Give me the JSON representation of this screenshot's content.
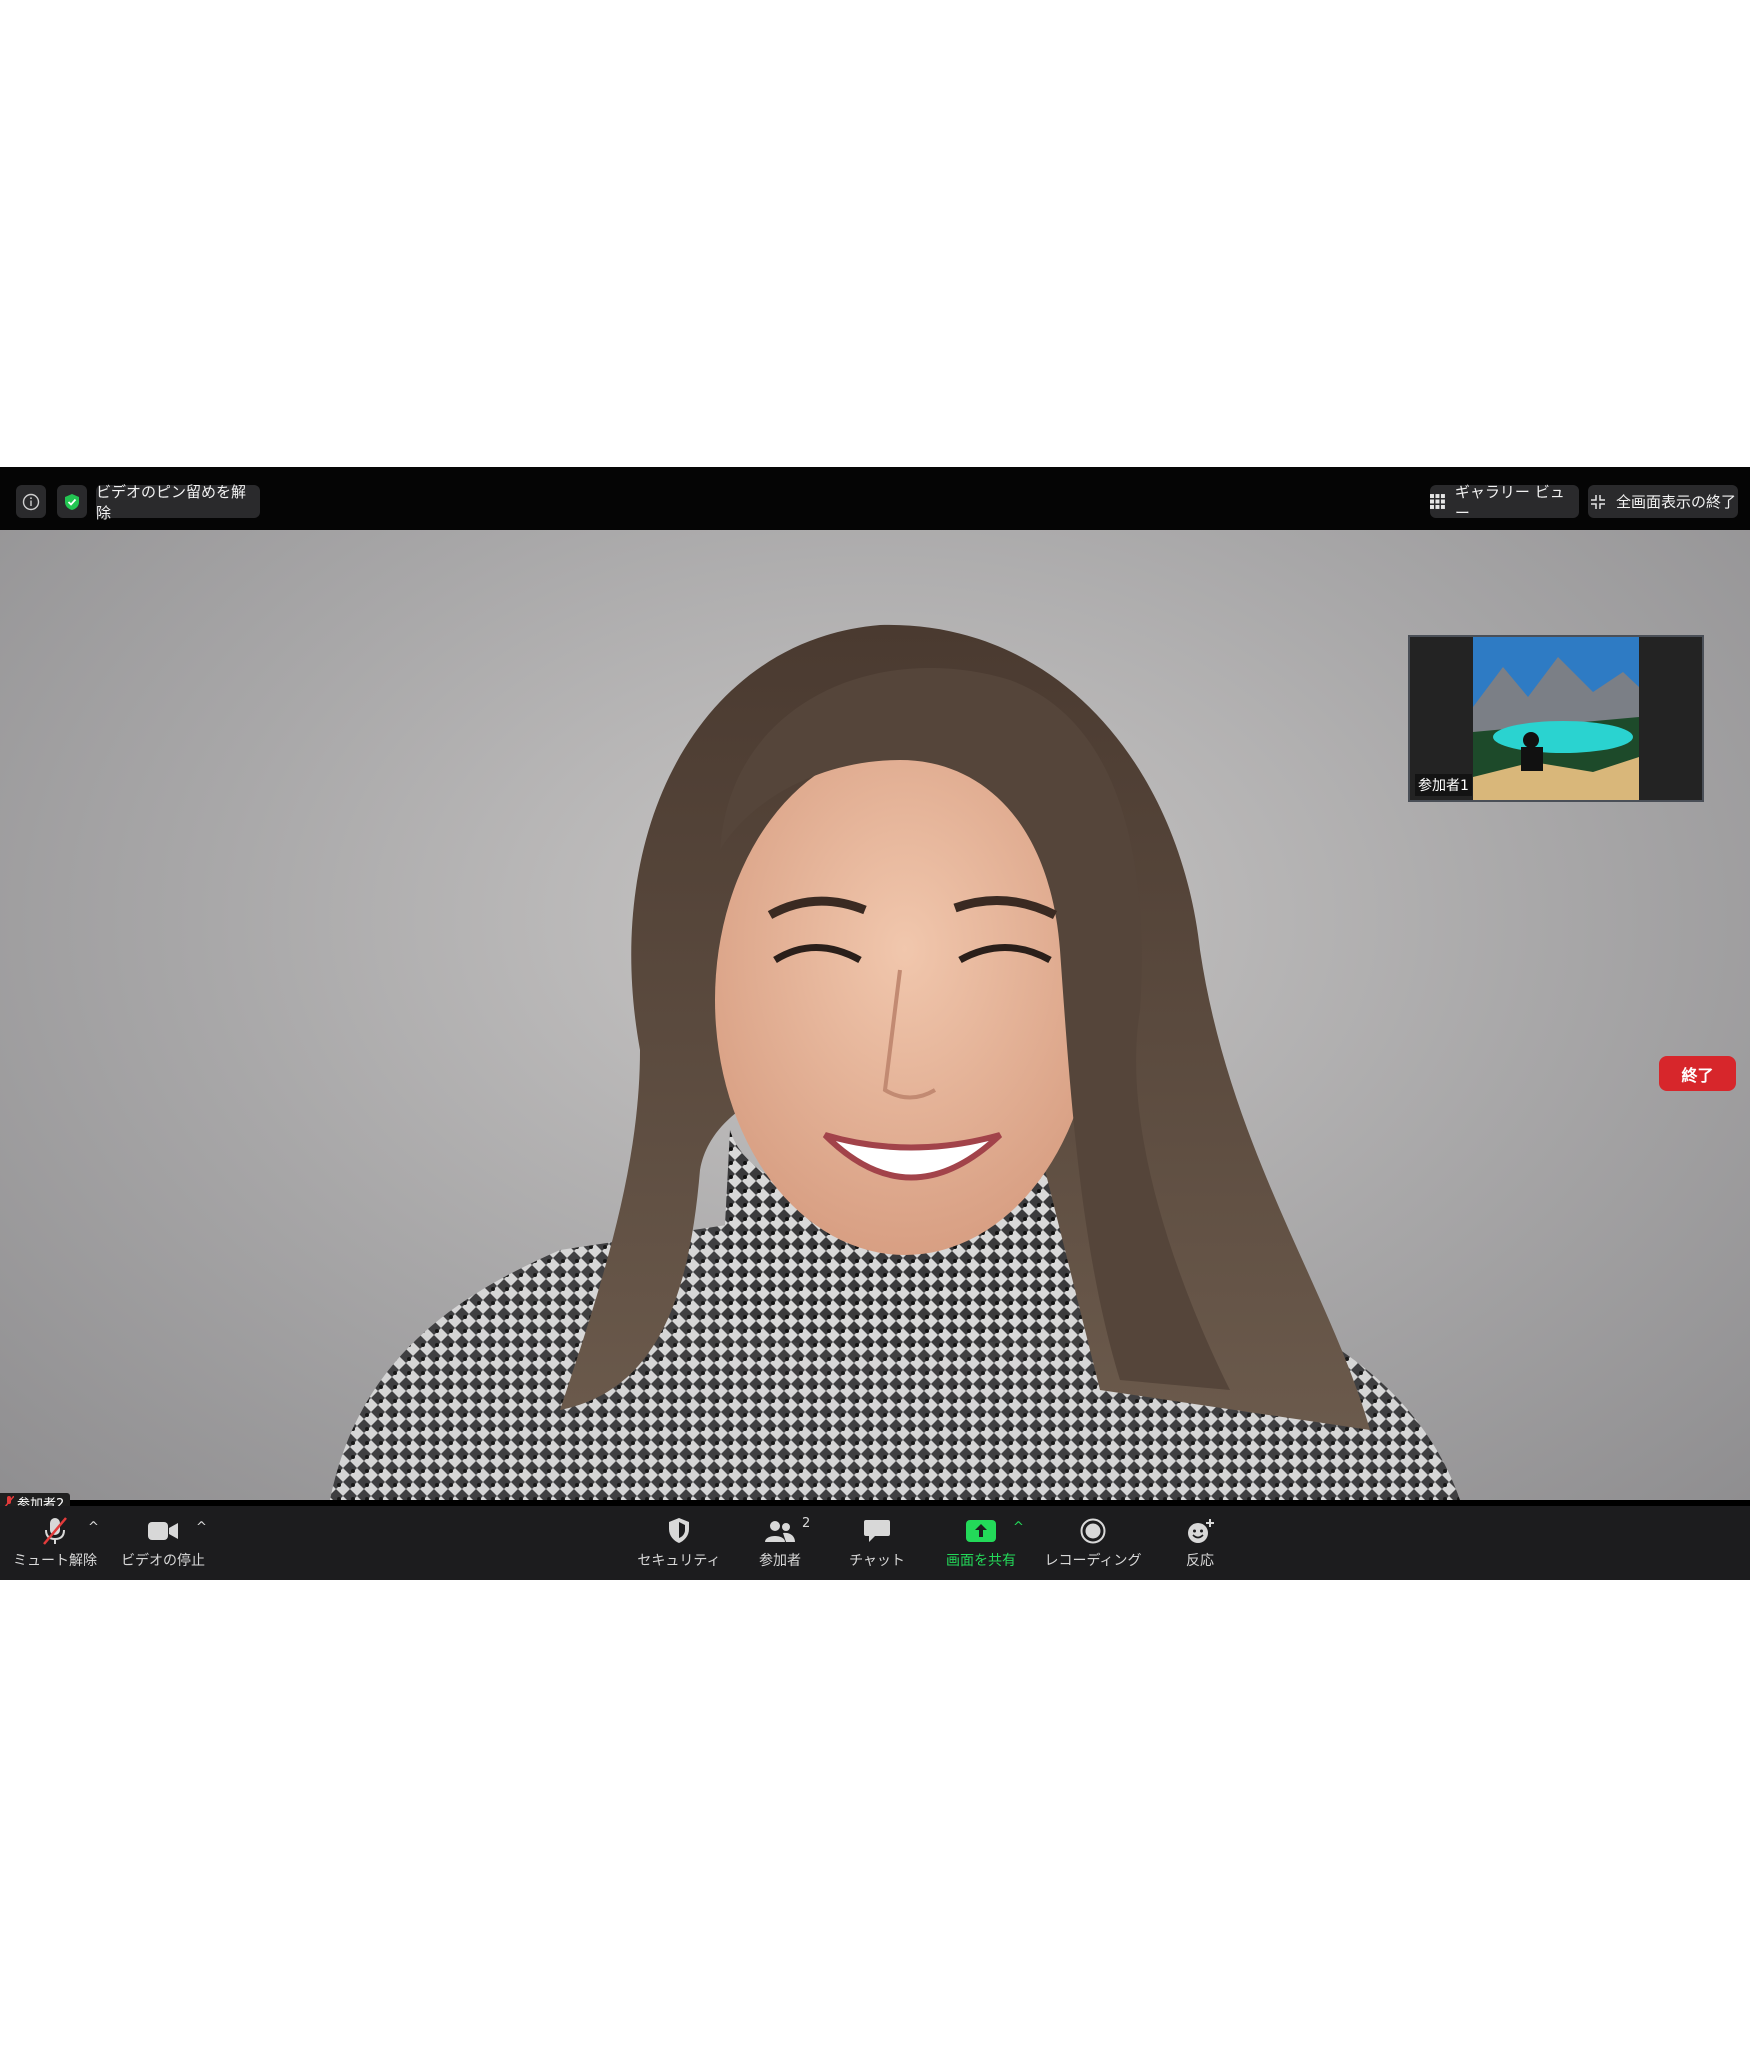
{
  "topbar": {
    "info_icon": "info-icon",
    "security_icon": "shield-check-icon",
    "unpin_label": "ビデオのピン留めを解除",
    "gallery_label": "ギャラリー ビュー",
    "exit_fullscreen_label": "全画面表示の終了"
  },
  "main_video": {
    "participant_name": "参加者2"
  },
  "thumbnail": {
    "participant_name": "参加者1"
  },
  "toolbar": {
    "unmute_label": "ミュート解除",
    "stop_video_label": "ビデオの停止",
    "security_label": "セキュリティ",
    "participants_label": "参加者",
    "participants_count": "2",
    "chat_label": "チャット",
    "share_label": "画面を共有",
    "record_label": "レコーディング",
    "reactions_label": "反応",
    "end_label": "終了"
  },
  "colors": {
    "share_green": "#23d959",
    "end_red": "#d7262b",
    "toolbar_bg": "#1c1c1e"
  }
}
